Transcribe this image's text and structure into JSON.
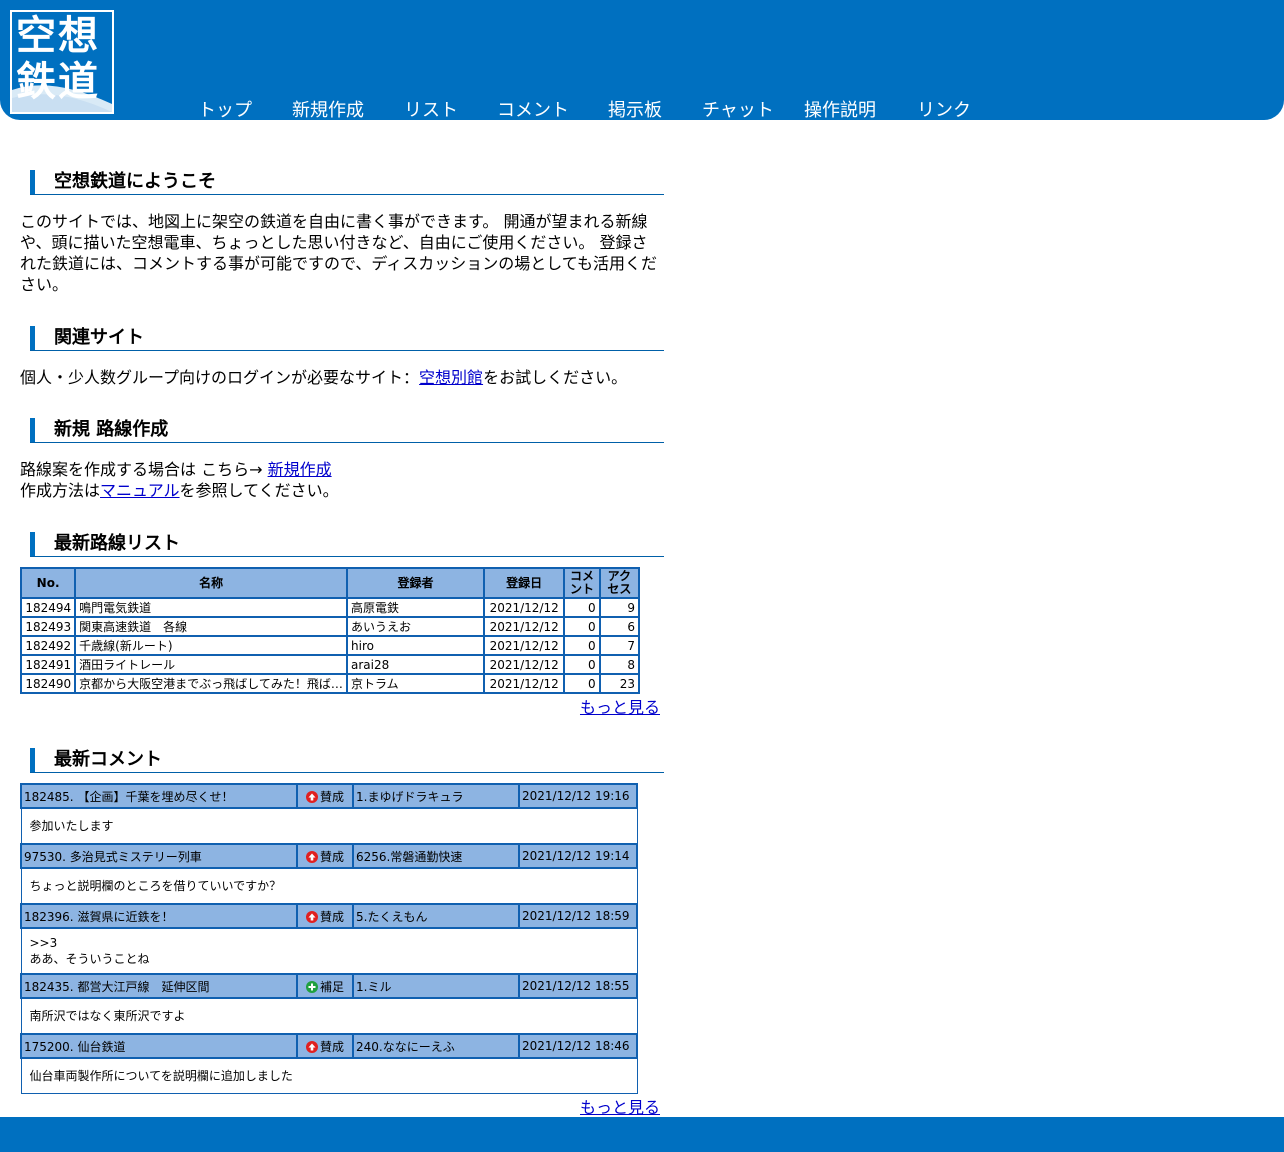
{
  "colors": {
    "brand": "#0070c0",
    "table_header": "#8db4e2",
    "link": "#0000cc",
    "agree": "#e02020",
    "supplement": "#20a040"
  },
  "logo": {
    "line1": "空想",
    "line2": "鉄道"
  },
  "nav": [
    "トップ",
    "新規作成",
    "リスト",
    "コメント",
    "掲示板",
    "チャット",
    "操作説明",
    "リンク"
  ],
  "welcome": {
    "title": "空想鉄道にようこそ",
    "text": "このサイトでは、地図上に架空の鉄道を自由に書く事ができます。 開通が望まれる新線や、頭に描いた空想電車、ちょっとした思い付きなど、自由にご使用ください。 登録された鉄道には、コメントする事が可能ですので、ディスカッションの場としても活用ください。"
  },
  "related": {
    "title": "関連サイト",
    "text_before": "個人・少人数グループ向けのログインが必要なサイト：",
    "link": "空想別館",
    "text_after": "をお試しください。"
  },
  "create": {
    "title": "新規 路線作成",
    "line1_text": "路線案を作成する場合は こちら→ ",
    "line1_link": "新規作成",
    "line2_before": "作成方法は",
    "line2_link": "マニュアル",
    "line2_after": "を参照してください。"
  },
  "routes": {
    "title": "最新路線リスト",
    "headers": {
      "no": "No.",
      "name": "名称",
      "author": "登録者",
      "date": "登録日",
      "comments": "コメント",
      "access": "アクセス"
    },
    "rows": [
      {
        "no": "182494",
        "name": "鳴門電気鉄道",
        "author": "高原電鉄",
        "date": "2021/12/12",
        "comments": "0",
        "access": "9"
      },
      {
        "no": "182493",
        "name": "関東高速鉄道　各線",
        "author": "あいうえお",
        "date": "2021/12/12",
        "comments": "0",
        "access": "6"
      },
      {
        "no": "182492",
        "name": "千歳線(新ルート)",
        "author": "hiro",
        "date": "2021/12/12",
        "comments": "0",
        "access": "7"
      },
      {
        "no": "182491",
        "name": "酒田ライトレール",
        "author": "arai28",
        "date": "2021/12/12",
        "comments": "0",
        "access": "8"
      },
      {
        "no": "182490",
        "name": "京都から大阪空港までぶっ飛ばしてみた！飛ば…",
        "author": "京トラム",
        "date": "2021/12/12",
        "comments": "0",
        "access": "23"
      }
    ],
    "more": "もっと見る"
  },
  "comments": {
    "title": "最新コメント",
    "rows": [
      {
        "route": "182485. 【企画】千葉を埋め尽くせ！",
        "type": "賛成",
        "icon": "agree-icon",
        "user": "1.まゆげドラキュラ",
        "time": "2021/12/12 19:16",
        "body": "参加いたします"
      },
      {
        "route": "97530. 多治見式ミステリー列車",
        "type": "賛成",
        "icon": "agree-icon",
        "user": "6256.常磐通勤快速",
        "time": "2021/12/12 19:14",
        "body": "ちょっと説明欄のところを借りていいですか？"
      },
      {
        "route": "182396. 滋賀県に近鉄を！",
        "type": "賛成",
        "icon": "agree-icon",
        "user": "5.たくえもん",
        "time": "2021/12/12 18:59",
        "body_lines": [
          ">>3",
          "ああ、そういうことね"
        ]
      },
      {
        "route": "182435. 都営大江戸線　延伸区間",
        "type": "補足",
        "icon": "supplement-icon",
        "user": "1.ミル",
        "time": "2021/12/12 18:55",
        "body": "南所沢ではなく東所沢ですよ"
      },
      {
        "route": "175200. 仙台鉄道",
        "type": "賛成",
        "icon": "agree-icon",
        "user": "240.ななにーえふ",
        "time": "2021/12/12 18:46",
        "body": "仙台車両製作所についてを説明欄に追加しました"
      }
    ],
    "more": "もっと見る"
  }
}
